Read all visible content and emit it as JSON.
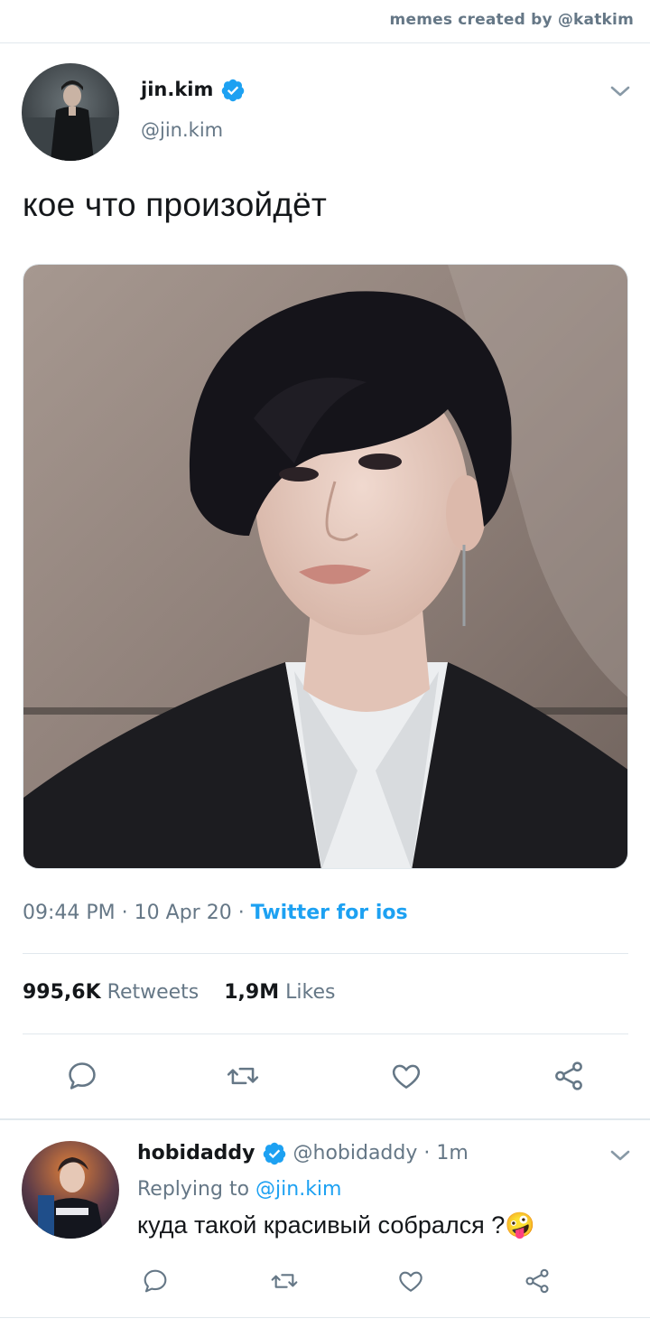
{
  "credit": "memes created by @katkim",
  "tweet": {
    "display_name": "jin.kim",
    "handle": "@jin.kim",
    "text": "кое что произойдёт",
    "time": "09:44 PM",
    "date": "10 Apr 20",
    "separator": "·",
    "source": "Twitter for ios",
    "retweets_count": "995,6K",
    "retweets_label": "Retweets",
    "likes_count": "1,9M",
    "likes_label": "Likes"
  },
  "reply": {
    "display_name": "hobidaddy",
    "handle": "@hobidaddy",
    "time": "1m",
    "replying_label": "Replying to",
    "replying_to": "@jin.kim",
    "text": "куда такой красивый собрался ?",
    "emoji": "🤪"
  },
  "colors": {
    "accent": "#1da1f2",
    "secondary_text": "#657786",
    "divider": "#e1e8ed"
  },
  "icons": [
    "verified-badge-icon",
    "chevron-down-icon",
    "reply-icon",
    "retweet-icon",
    "like-icon",
    "share-icon"
  ]
}
